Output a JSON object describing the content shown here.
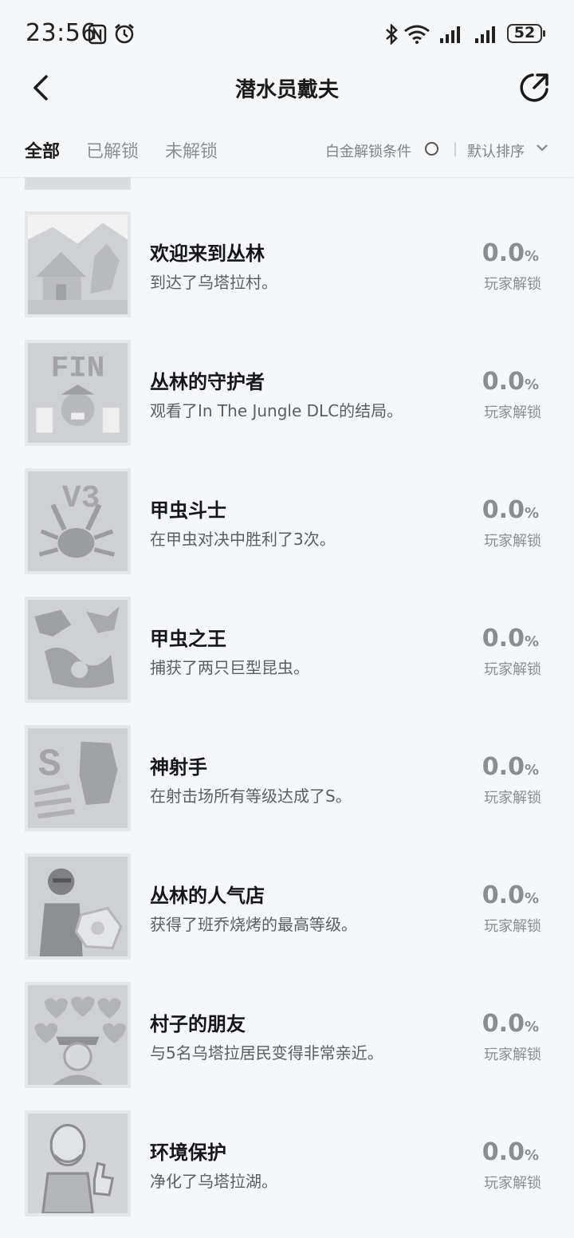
{
  "status": {
    "time": "23:56",
    "battery": "52"
  },
  "header": {
    "title": "潜水员戴夫"
  },
  "filters": {
    "tabs": [
      "全部",
      "已解锁",
      "未解锁"
    ],
    "platinum_condition": "白金解锁条件",
    "separator": "|",
    "sort": "默认排序"
  },
  "achievements": [
    {
      "name": "欢迎来到丛林",
      "desc": "到达了乌塔拉村。",
      "percent": "0.0",
      "unit": "%",
      "label": "玩家解锁",
      "icon": "jungle-village-icon"
    },
    {
      "name": "丛林的守护者",
      "desc": "观看了In The Jungle DLC的结局。",
      "percent": "0.0",
      "unit": "%",
      "label": "玩家解锁",
      "icon": "fin-icon",
      "icon_text": "FIN"
    },
    {
      "name": "甲虫斗士",
      "desc": "在甲虫对决中胜利了3次。",
      "percent": "0.0",
      "unit": "%",
      "label": "玩家解锁",
      "icon": "beetle-v3-icon",
      "icon_text": "V3"
    },
    {
      "name": "甲虫之王",
      "desc": "捕获了两只巨型昆虫。",
      "percent": "0.0",
      "unit": "%",
      "label": "玩家解锁",
      "icon": "giant-insects-icon"
    },
    {
      "name": "神射手",
      "desc": "在射击场所有等级达成了S。",
      "percent": "0.0",
      "unit": "%",
      "label": "玩家解锁",
      "icon": "shooting-s-icon",
      "icon_text": "S"
    },
    {
      "name": "丛林的人气店",
      "desc": "获得了班乔烧烤的最高等级。",
      "percent": "0.0",
      "unit": "%",
      "label": "玩家解锁",
      "icon": "bbq-shop-icon"
    },
    {
      "name": "村子的朋友",
      "desc": "与5名乌塔拉居民变得非常亲近。",
      "percent": "0.0",
      "unit": "%",
      "label": "玩家解锁",
      "icon": "hearts-villager-icon"
    },
    {
      "name": "环境保护",
      "desc": "净化了乌塔拉湖。",
      "percent": "0.0",
      "unit": "%",
      "label": "玩家解锁",
      "icon": "old-man-thumbs-up-icon"
    }
  ]
}
